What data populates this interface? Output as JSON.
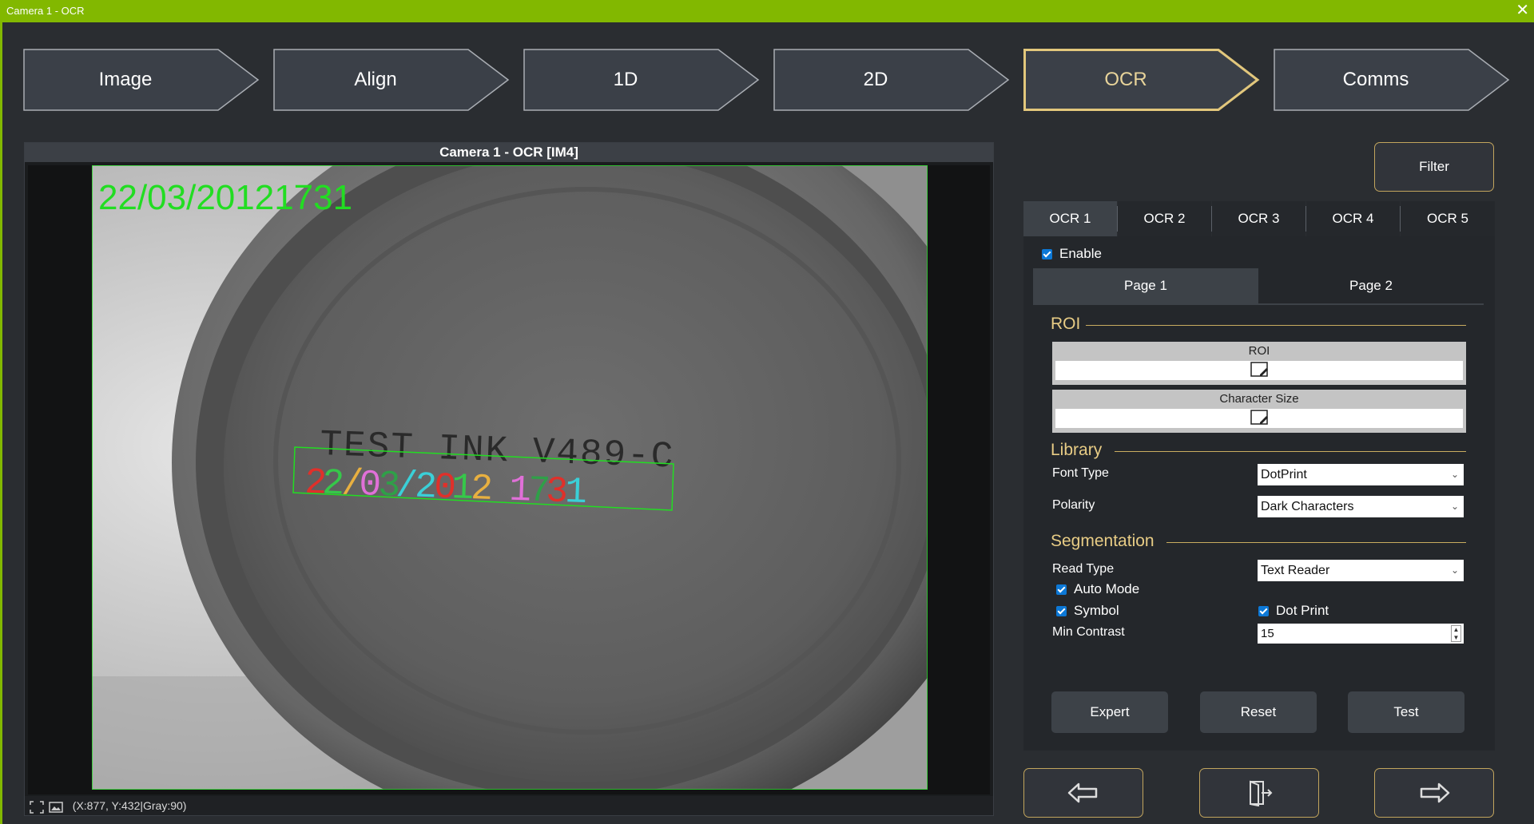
{
  "window": {
    "title": "Camera 1 - OCR",
    "close_glyph": "✕"
  },
  "steps": [
    {
      "label": "Image",
      "active": false
    },
    {
      "label": "Align",
      "active": false
    },
    {
      "label": "1D",
      "active": false
    },
    {
      "label": "2D",
      "active": false
    },
    {
      "label": "OCR",
      "active": true
    },
    {
      "label": "Comms",
      "active": false
    }
  ],
  "image_panel": {
    "header": "Camera 1 - OCR  [IM4]",
    "overlay_result": "22/03/20121731",
    "printed_line1": "TEST INK V489-C",
    "read_chars": [
      {
        "ch": "2",
        "color": "#e0302a"
      },
      {
        "ch": "2",
        "color": "#36c84a"
      },
      {
        "ch": "/",
        "color": "#e8b040"
      },
      {
        "ch": "0",
        "color": "#e070d8"
      },
      {
        "ch": "3",
        "color": "#2fa048"
      },
      {
        "ch": "/",
        "color": "#3ad0d8"
      },
      {
        "ch": "2",
        "color": "#3ad0d8"
      },
      {
        "ch": "0",
        "color": "#e0302a"
      },
      {
        "ch": "1",
        "color": "#36c84a"
      },
      {
        "ch": "2",
        "color": "#e8b040"
      },
      {
        "ch": "1",
        "color": "#e070d8"
      },
      {
        "ch": "7",
        "color": "#2fa048"
      },
      {
        "ch": "3",
        "color": "#e0302a"
      },
      {
        "ch": "1",
        "color": "#3ad0d8"
      }
    ],
    "status_text": "(X:877, Y:432|Gray:90)"
  },
  "filter_label": "Filter",
  "ocr_tabs": [
    "OCR 1",
    "OCR 2",
    "OCR 3",
    "OCR 4",
    "OCR 5"
  ],
  "ocr_tab_active": 0,
  "enable_label": "Enable",
  "page_tabs": [
    "Page 1",
    "Page 2"
  ],
  "page_tab_active": 0,
  "roi": {
    "section": "ROI",
    "roi_label": "ROI",
    "char_size_label": "Character Size"
  },
  "library": {
    "section": "Library",
    "font_type_label": "Font Type",
    "font_type_value": "DotPrint",
    "polarity_label": "Polarity",
    "polarity_value": "Dark Characters"
  },
  "segmentation": {
    "section": "Segmentation",
    "read_type_label": "Read Type",
    "read_type_value": "Text Reader",
    "auto_mode_label": "Auto Mode",
    "symbol_label": "Symbol",
    "dot_print_label": "Dot Print",
    "min_contrast_label": "Min Contrast",
    "min_contrast_value": "15"
  },
  "actions": {
    "expert": "Expert",
    "reset": "Reset",
    "test": "Test"
  },
  "nav": {
    "prev_icon": "arrow-left-icon",
    "exit_icon": "exit-door-icon",
    "next_icon": "arrow-right-icon"
  },
  "colors": {
    "accent": "#82b800",
    "gold": "#c2a55d",
    "ok_green": "#22dd22"
  }
}
